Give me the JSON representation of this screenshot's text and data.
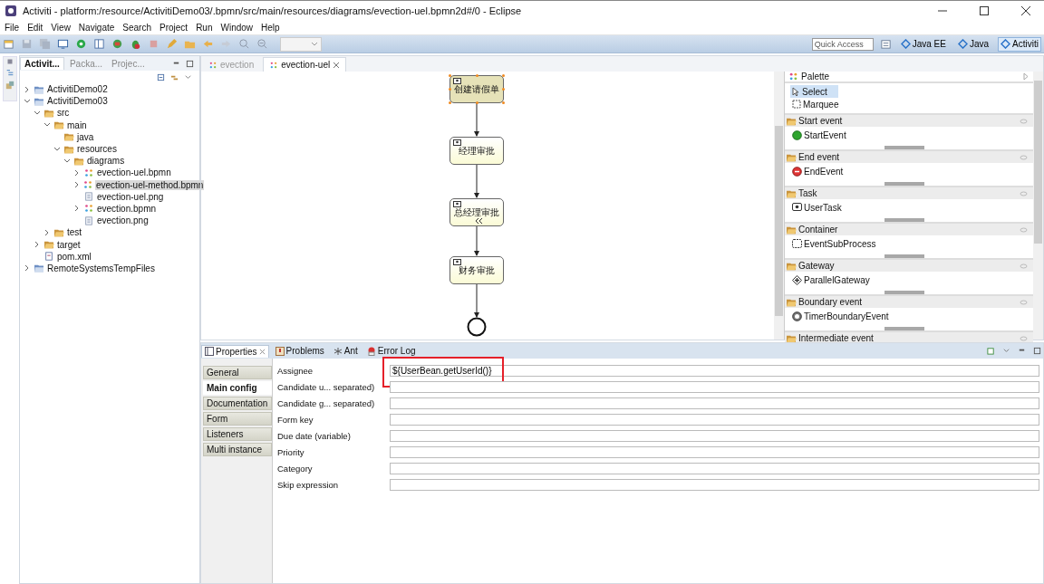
{
  "window": {
    "title": "Activiti - platform:/resource/ActivitiDemo03/.bpmn/src/main/resources/diagrams/evection-uel.bpmn2d#/0 - Eclipse"
  },
  "menu": [
    "File",
    "Edit",
    "View",
    "Navigate",
    "Search",
    "Project",
    "Run",
    "Window",
    "Help"
  ],
  "toolbar": {
    "quick_access": {
      "placeholder": "Quick Access"
    },
    "perspectives": [
      {
        "label": "Java EE",
        "selected": false
      },
      {
        "label": "Java",
        "selected": false
      },
      {
        "label": "Activiti",
        "selected": true
      }
    ]
  },
  "explorer": {
    "tabs": [
      {
        "label": "Activit...",
        "selected": true
      },
      {
        "label": "Packa...",
        "selected": false
      },
      {
        "label": "Projec...",
        "selected": false
      }
    ],
    "tree": [
      {
        "label": "ActivitiDemo02",
        "kind": "project",
        "expanded": false,
        "selected": false
      },
      {
        "label": "ActivitiDemo03",
        "kind": "project",
        "expanded": true,
        "selected": false,
        "children": [
          {
            "label": "src",
            "kind": "folder",
            "expanded": true,
            "selected": false,
            "children": [
              {
                "label": "main",
                "kind": "folder",
                "expanded": true,
                "selected": false,
                "children": [
                  {
                    "label": "java",
                    "kind": "folder",
                    "selected": false
                  },
                  {
                    "label": "resources",
                    "kind": "folder",
                    "expanded": true,
                    "selected": false,
                    "children": [
                      {
                        "label": "diagrams",
                        "kind": "folder",
                        "expanded": true,
                        "selected": false,
                        "children": [
                          {
                            "label": "evection-uel.bpmn",
                            "kind": "bpmn",
                            "expanded": false,
                            "selected": false
                          },
                          {
                            "label": "evection-uel-method.bpmn",
                            "kind": "bpmn",
                            "expanded": false,
                            "selected": true
                          },
                          {
                            "label": "evection-uel.png",
                            "kind": "file",
                            "selected": false
                          },
                          {
                            "label": "evection.bpmn",
                            "kind": "bpmn",
                            "expanded": false,
                            "selected": false
                          },
                          {
                            "label": "evection.png",
                            "kind": "file",
                            "selected": false
                          }
                        ]
                      }
                    ]
                  }
                ]
              },
              {
                "label": "test",
                "kind": "folder",
                "expanded": false,
                "selected": false
              }
            ]
          },
          {
            "label": "target",
            "kind": "folder",
            "expanded": false,
            "selected": false
          },
          {
            "label": "pom.xml",
            "kind": "xml",
            "selected": false
          }
        ]
      },
      {
        "label": "RemoteSystemsTempFiles",
        "kind": "project",
        "expanded": false,
        "selected": false
      }
    ]
  },
  "editor": {
    "tabs": [
      {
        "label": "evection",
        "selected": false
      },
      {
        "label": "evection-uel",
        "selected": true
      }
    ],
    "diagram": {
      "tasks": [
        {
          "label": "创建请假单",
          "selected": true,
          "marker": false
        },
        {
          "label": "经理审批",
          "selected": false,
          "marker": false
        },
        {
          "label": "总经理审批",
          "selected": false,
          "marker": true
        },
        {
          "label": "财务审批",
          "selected": false,
          "marker": false
        }
      ]
    },
    "palette": {
      "title": "Palette",
      "tools": [
        {
          "label": "Select",
          "kind": "select",
          "selected": true
        },
        {
          "label": "Marquee",
          "kind": "marquee",
          "selected": false
        }
      ],
      "sections": [
        {
          "label": "Start event",
          "item": {
            "label": "StartEvent",
            "kind": "start",
            "selected": false
          }
        },
        {
          "label": "End event",
          "item": {
            "label": "EndEvent",
            "kind": "end",
            "selected": false
          }
        },
        {
          "label": "Task",
          "item": {
            "label": "UserTask",
            "kind": "task",
            "selected": false
          }
        },
        {
          "label": "Container",
          "item": {
            "label": "EventSubProcess",
            "kind": "subprocess",
            "selected": false
          }
        },
        {
          "label": "Gateway",
          "item": {
            "label": "ParallelGateway",
            "kind": "gateway",
            "selected": false
          }
        },
        {
          "label": "Boundary event",
          "item": {
            "label": "TimerBoundaryEvent",
            "kind": "timer",
            "selected": false
          }
        },
        {
          "label": "Intermediate event"
        }
      ]
    }
  },
  "properties": {
    "tabs": [
      {
        "label": "Properties",
        "kind": "properties",
        "selected": true
      },
      {
        "label": "Problems",
        "kind": "problems",
        "selected": false
      },
      {
        "label": "Ant",
        "kind": "ant",
        "selected": false
      },
      {
        "label": "Error Log",
        "kind": "log",
        "selected": false
      }
    ],
    "sections": [
      {
        "label": "General",
        "selected": false
      },
      {
        "label": "Main config",
        "selected": true
      },
      {
        "label": "Documentation",
        "selected": false
      },
      {
        "label": "Form",
        "selected": false
      },
      {
        "label": "Listeners",
        "selected": false
      },
      {
        "label": "Multi instance",
        "selected": false
      }
    ],
    "fields": [
      {
        "label": "Assignee",
        "value": "${UserBean.getUserId()}",
        "highlighted": true
      },
      {
        "label": "Candidate u... separated)",
        "highlighted": false
      },
      {
        "label": "Candidate g... separated)",
        "highlighted": false
      },
      {
        "label": "Form key",
        "highlighted": false
      },
      {
        "label": "Due date (variable)",
        "highlighted": false
      },
      {
        "label": "Priority",
        "highlighted": false
      },
      {
        "label": "Category",
        "highlighted": false
      },
      {
        "label": "Skip expression",
        "highlighted": false
      }
    ]
  }
}
